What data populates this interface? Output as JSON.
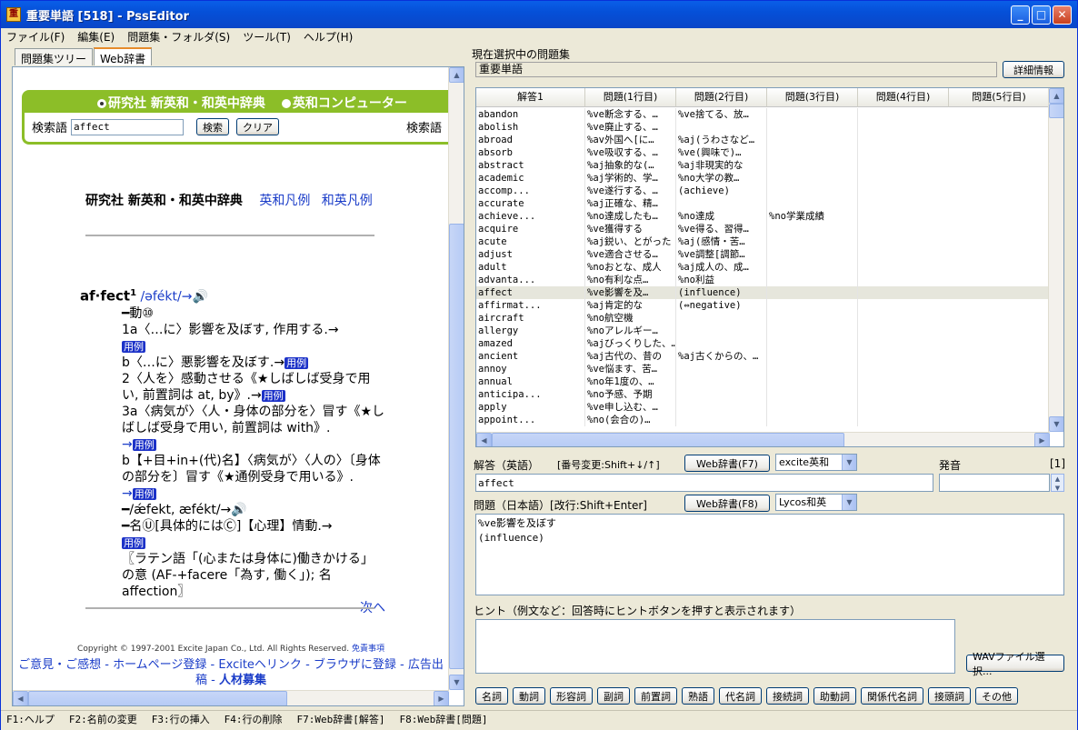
{
  "window": {
    "title": "重要単語 [518] - PssEditor",
    "icon": "app-book-icon"
  },
  "menu": [
    "ファイル(F)",
    "編集(E)",
    "問題集・フォルダ(S)",
    "ツール(T)",
    "ヘルプ(H)"
  ],
  "left_tabs": [
    "問題集ツリー",
    "Web辞書"
  ],
  "web": {
    "dict_option1": "研究社 新英和・和英中辞典",
    "dict_option2": "英和コンピューター",
    "search_label": "検索語",
    "search_value": "affect",
    "search_button": "検索",
    "clear_button": "クリア",
    "search_label_right": "検索語",
    "dict_title": "研究社 新英和・和英中辞典",
    "link1": "英和凡例",
    "link2": "和英凡例",
    "headword": "af·fect",
    "headword_sup": "1",
    "pron": "/əfékt/→",
    "sense_head": "━動⑩",
    "s1a": "1a〈…に〉影響を及ぼす, 作用する.→",
    "s1b": "b〈…に〉悪影響を及ぼす.→",
    "s2": "2〈人を〉感動させる《★しばしば受身で用い, 前置詞は at, by》.→",
    "s3a": "3a〈病気が〉〈人・身体の部分を〉冒す《★しばしば受身で用い, 前置詞は with》.",
    "s3a_arrow": "→",
    "s3b": "b【+目+in+(代)名】〈病気が〉〈人の〉〔身体の部分を〕冒す《★通例受身で用いる》.",
    "s3b_arrow": "→",
    "noun_pron": "━/ǽfekt, æfékt/→",
    "noun": "━名Ⓤ[具体的にはⒸ]【心理】情動.→",
    "etym": "〖ラテン語「(心または身体に)働きかける」の意 (AF-+facere「為す, 働く」); 名 affection〗",
    "reibun": "用例",
    "next": "次へ",
    "copyright": "Copyright © 1997-2001 Excite Japan Co., Ltd. All Rights Reserved.",
    "disclaimer": "免責事項",
    "footer_links": [
      "ご意見・ご感想",
      "ホームページ登録",
      "Exciteヘリンク",
      "ブラウザに登録",
      "広告出稿",
      "人材募集"
    ]
  },
  "right": {
    "current_label": "現在選択中の問題集",
    "current_value": "重要単語",
    "detail_button": "詳細情報",
    "columns": [
      "解答1",
      "問題(1行目)",
      "問題(2行目)",
      "問題(3行目)",
      "問題(4行目)",
      "問題(5行目)"
    ],
    "rows": [
      [
        "abandon",
        "%ve断念する、…",
        "%ve捨てる、放…",
        ""
      ],
      [
        "abolish",
        "%ve廃止する、…",
        "",
        ""
      ],
      [
        "abroad",
        "%av外国へ[に…",
        "%aj(うわさなど…",
        ""
      ],
      [
        "absorb",
        "%ve吸収する、…",
        "%ve(興味で)…",
        ""
      ],
      [
        "abstract",
        "%aj抽象的な(…",
        "%aj非現実的な",
        ""
      ],
      [
        "academic",
        "%aj学術的、学…",
        "%no大学の教…",
        ""
      ],
      [
        "accomp...",
        "%ve遂行する、…",
        "(achieve)",
        ""
      ],
      [
        "accurate",
        "%aj正確な、精…",
        "",
        ""
      ],
      [
        "achieve...",
        "%no達成したも…",
        "%no達成",
        "%no学業成績"
      ],
      [
        "acquire",
        "%ve獲得する",
        "%ve得る、習得…",
        ""
      ],
      [
        "acute",
        "%aj鋭い、とがった",
        "%aj(感情・苦…",
        ""
      ],
      [
        "adjust",
        "%ve適合させる…",
        "%ve調整[調節…",
        ""
      ],
      [
        "adult",
        "%noおとな、成人",
        "%aj成人の、成…",
        ""
      ],
      [
        "advanta...",
        "%no有利な点…",
        "%no利益",
        ""
      ],
      [
        "affect",
        "%ve影響を及…",
        "(influence)",
        ""
      ],
      [
        "affirmat...",
        "%aj肯定的な",
        "(⇔negative)",
        ""
      ],
      [
        "aircraft",
        "%no航空機",
        "",
        ""
      ],
      [
        "allergy",
        "%noアレルギー…",
        "",
        ""
      ],
      [
        "amazed",
        "%ajびっくりした、…",
        "",
        ""
      ],
      [
        "ancient",
        "%aj古代の、昔の",
        "%aj古くからの、…",
        ""
      ],
      [
        "annoy",
        "%ve悩ます、苦…",
        "",
        ""
      ],
      [
        "annual",
        "%no年1度の、…",
        "",
        ""
      ],
      [
        "anticipa...",
        "%no予感、予期",
        "",
        ""
      ],
      [
        "apply",
        "%ve申し込む、…",
        "",
        ""
      ],
      [
        "appoint...",
        "%no(会合の)…",
        "",
        ""
      ]
    ],
    "answer_label": "解答（英語）",
    "answer_hint": "[番号変更:Shift+↓/↑]",
    "web_button_f7": "Web辞書(F7)",
    "dict_en": "excite英和",
    "pron_label": "発音",
    "index": "[1]",
    "answer_value": "affect",
    "question_label": "問題（日本語）[改行:Shift+Enter]",
    "web_button_f8": "Web辞書(F8)",
    "dict_ja": "Lycos和英",
    "question_line1": "%ve影響を及ぼす",
    "question_line2": "(influence)",
    "hint_label": "ヒント（例文など：回答時にヒントボタンを押すと表示されます）",
    "wav_button": "WAVファイル選択...",
    "pos_buttons": [
      "名詞",
      "動詞",
      "形容詞",
      "副詞",
      "前置詞",
      "熟語",
      "代名詞",
      "接続詞",
      "助動詞",
      "関係代名詞",
      "接頭詞",
      "その他"
    ]
  },
  "status": [
    "F1:ヘルプ",
    "F2:名前の変更",
    "F3:行の挿入",
    "F4:行の削除",
    "F7:Web辞書[解答]",
    "F8:Web辞書[問題]"
  ]
}
